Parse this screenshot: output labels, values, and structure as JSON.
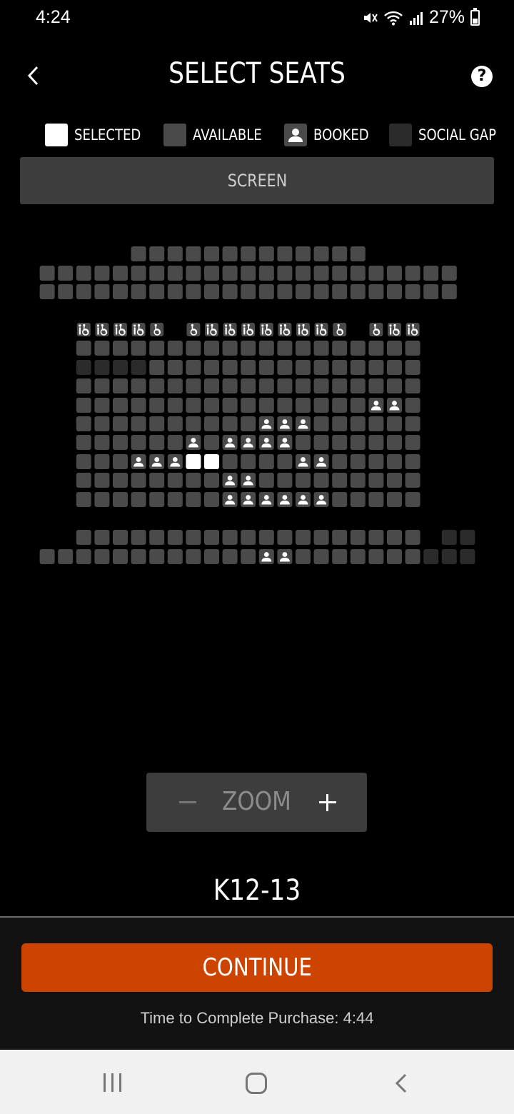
{
  "status_bar": {
    "time": "4:24",
    "battery": "27%"
  },
  "header": {
    "title": "SELECT SEATS",
    "help_label": "?"
  },
  "legend": [
    {
      "key": "selected",
      "label": "SELECTED"
    },
    {
      "key": "available",
      "label": "AVAILABLE"
    },
    {
      "key": "booked",
      "label": "BOOKED"
    },
    {
      "key": "social_gap",
      "label": "SOCIAL GAP"
    }
  ],
  "screen_label": "SCREEN",
  "seat_map": {
    "colors": {
      "available": "#4a4a4a",
      "social_gap": "#2b2b2b",
      "selected": "#ffffff",
      "booked": "#4a4a4a",
      "booked_icon": "#ffffff"
    },
    "rows": [
      "......AAAAAAAAAAAAA......",
      ".AAAAAAAAAAAAAAAAAAAAAAA.",
      ".AAAAAAAAAAAAAAAAAAAAAAA.",
      "",
      "...CCCCW.WCCCCCCCW.WCC...",
      "...AAAAAAAAAAAAAAAAAAA...",
      "...GGGGAAAAAAAAAAAAAAA...",
      "...AAAAAAAAAAAAAAAAAAA...",
      "...AAAAAAAAAAAAAAAABBA...",
      "...AAAAAAAAAABBBAAAAAA...",
      "...AAAAAABABBBBAAAAAAA...",
      "...AAABBBSSAAAABBAAAAA...",
      "...AAAAAAAABBAAAAAAAAA...",
      "...AAAAAAAABBBBBBAAAAA...",
      "",
      "...AAAAAAAAAAAAAAAAAAA.GG",
      ".AAAAAAAAAAAABBAAAAAAAGGG"
    ]
  },
  "zoom": {
    "label": "ZOOM"
  },
  "selected_seats": "K12-13",
  "continue_label": "CONTINUE",
  "timer": {
    "text": "Time to Complete Purchase:  4:44"
  },
  "icons": {
    "back": "chevron-left-icon",
    "help": "question-circle-icon",
    "booked": "person-icon",
    "wheelchair": "wheelchair-icon",
    "companion": "companion-seat-icon"
  }
}
